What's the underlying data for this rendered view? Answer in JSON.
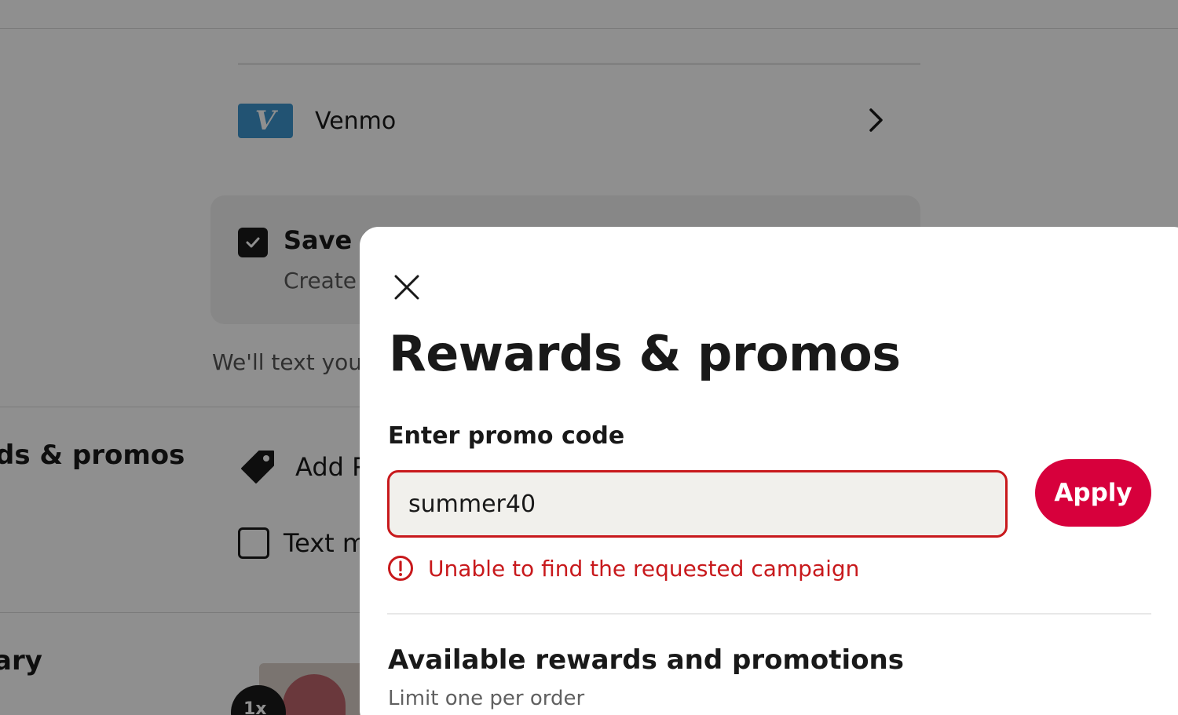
{
  "background": {
    "payment_method": {
      "label": "Venmo",
      "logo_letter": "V",
      "logo_color": "#3d95ce"
    },
    "save_card": {
      "title": "Save C",
      "subtitle": "Create"
    },
    "text_notice": "We'll text you",
    "sidebar_promos_heading": "ds & promos",
    "add_promo_label": "Add P",
    "text_option_label": "Text m",
    "sidebar_summary_heading": "ary",
    "item_quantity_badge": "1x"
  },
  "modal": {
    "title": "Rewards & promos",
    "promo_code": {
      "label": "Enter promo code",
      "value": "summer40",
      "apply_label": "Apply",
      "error_message": "Unable to find the requested campaign"
    },
    "available": {
      "title": "Available rewards and promotions",
      "subtitle": "Limit one per order"
    }
  },
  "colors": {
    "brand_red": "#d7003c",
    "error_red": "#c8191c",
    "overlay": "rgba(0,0,0,0.44)"
  },
  "icons": [
    "venmo-logo-icon",
    "chevron-right-icon",
    "checkmark-icon",
    "tag-icon",
    "close-icon",
    "error-icon"
  ]
}
